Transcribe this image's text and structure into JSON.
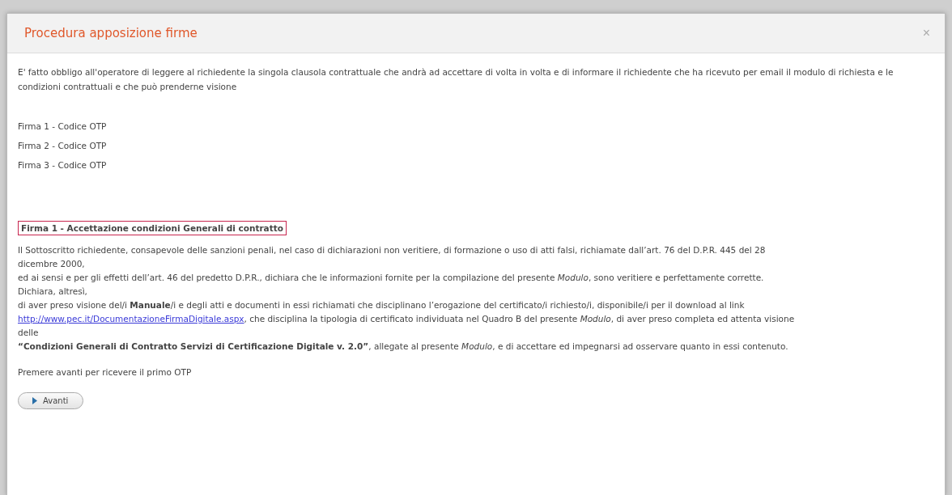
{
  "dialog": {
    "title": "Procedura apposizione firme",
    "close": "×"
  },
  "intro": "E' fatto obbligo all'operatore di leggere al richiedente la singola clausola contrattuale che andrà ad accettare di volta in volta e di informare il richiedente che ha ricevuto per email il modulo di richiesta e le condizioni contrattuali e che può prenderne visione",
  "signatures": [
    "Firma 1 - Codice OTP",
    "Firma 2 - Codice OTP",
    "Firma 3 - Codice OTP"
  ],
  "clause": {
    "heading": "Firma 1 - Accettazione condizioni Generali di contratto",
    "lines": [
      {
        "text": "Il Sottoscritto richiedente, consapevole delle sanzioni penali, nel caso di dichiarazioni non veritiere, di formazione o uso di atti falsi, richiamate dall’art. 76 del D.P.R. 445 del 28"
      },
      {
        "text": "dicembre 2000,"
      },
      {
        "text": "ed ai sensi e per gli effetti dell’art. 46 del predetto D.P.R., dichiara che le informazioni fornite per la compilazione del presente *Modulo*, sono veritiere e perfettamente corrette."
      },
      {
        "text": "Dichiara, altresì,"
      },
      {
        "text": "di aver preso visione del/i **Manuale**/i e degli atti e documenti in essi richiamati che disciplinano l’erogazione del certificato/i richiesto/i, disponibile/i per il download al link"
      },
      {
        "link": "http://www.pec.it/DocumentazioneFirmaDigitale.aspx",
        "text": ", che disciplina la tipologia di certificato individuata nel Quadro B del presente *Modulo*, di aver preso completa ed attenta visione"
      },
      {
        "text": "delle"
      },
      {
        "text": "**“Condizioni Generali di Contratto Servizi di Certificazione Digitale v. 2.0”**, allegate al presente *Modulo*, e di accettare ed impegnarsi ad osservare quanto in essi contenuto."
      }
    ]
  },
  "prompt": "Premere avanti per ricevere il primo OTP",
  "buttons": [
    {
      "label": "Avanti",
      "kind": "next"
    }
  ]
}
